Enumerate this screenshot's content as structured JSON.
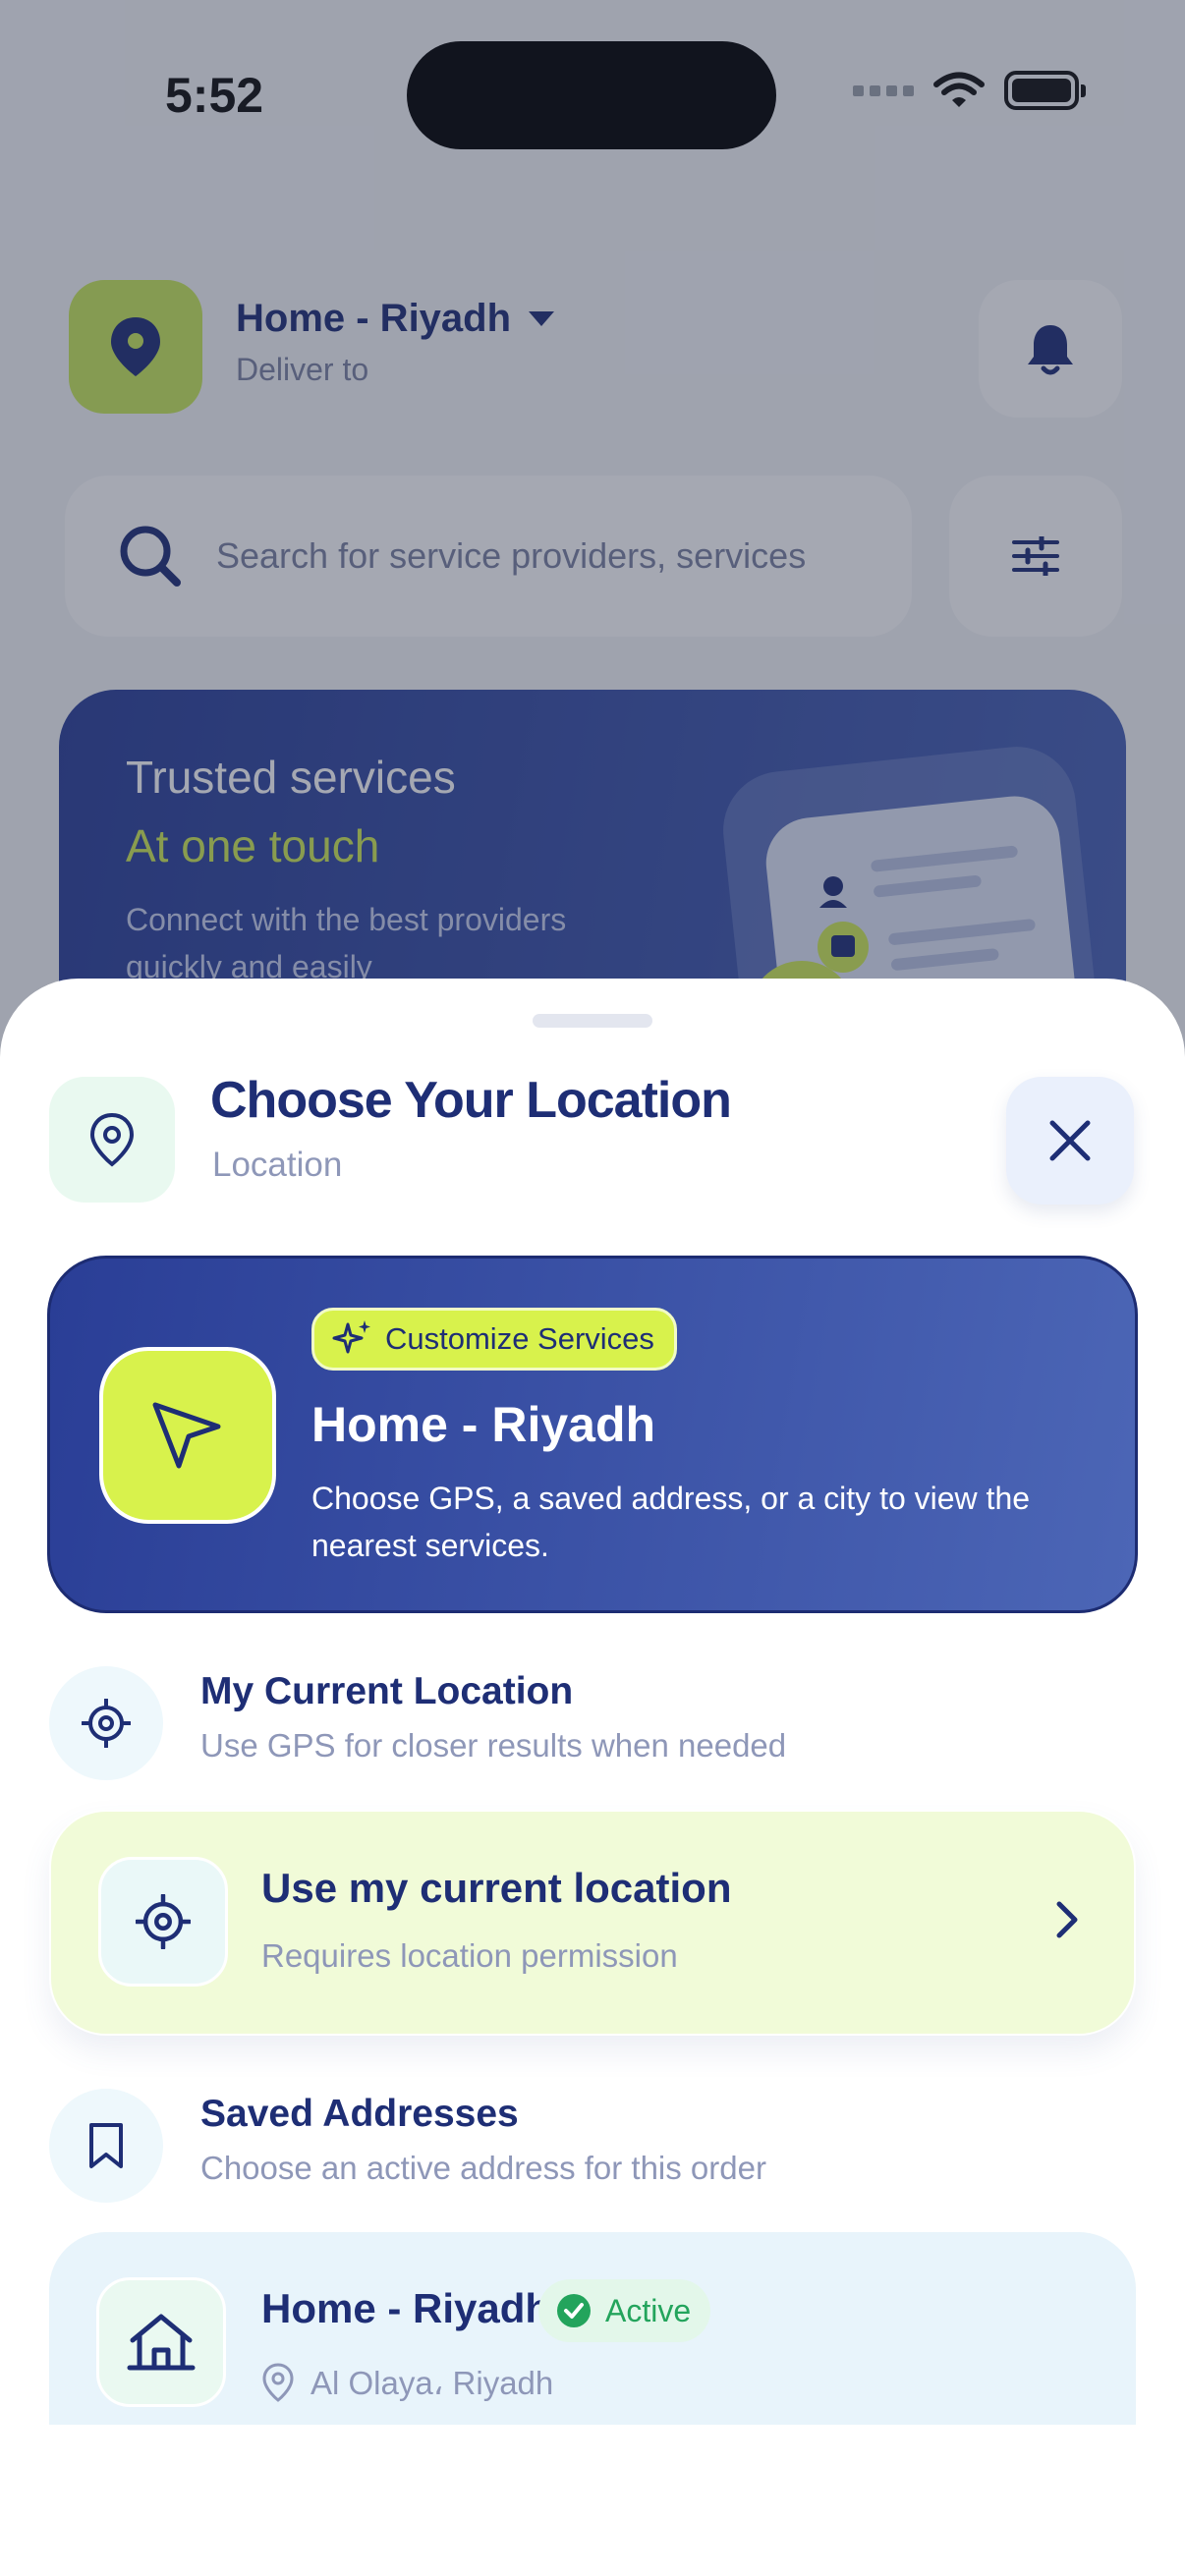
{
  "status_bar": {
    "time": "5:52"
  },
  "header": {
    "location_title": "Home - Riyadh",
    "location_subtitle": "Deliver to"
  },
  "search": {
    "placeholder": "Search for service providers, services"
  },
  "promo": {
    "title": "Trusted services",
    "highlight": "At one touch",
    "description": "Connect with the best providers quickly and easily"
  },
  "sheet": {
    "title": "Choose Your Location",
    "subtitle": "Location",
    "hero": {
      "badge": "Customize Services",
      "title": "Home - Riyadh",
      "description": "Choose GPS, a saved address, or a city to view the nearest services."
    },
    "current_location": {
      "title": "My Current Location",
      "subtitle": "Use GPS for closer results when needed",
      "card_title": "Use my current location",
      "card_subtitle": "Requires location permission"
    },
    "saved_addresses": {
      "title": "Saved Addresses",
      "subtitle": "Choose an active address for this order",
      "items": [
        {
          "name": "Home - Riyadh",
          "status": "Active",
          "address": "Al Olaya، Riyadh"
        }
      ]
    }
  },
  "colors": {
    "navy": "#1e2e75",
    "lime": "#d8f24c",
    "muted_text": "#8e97b8",
    "active_green": "#23a45c"
  }
}
